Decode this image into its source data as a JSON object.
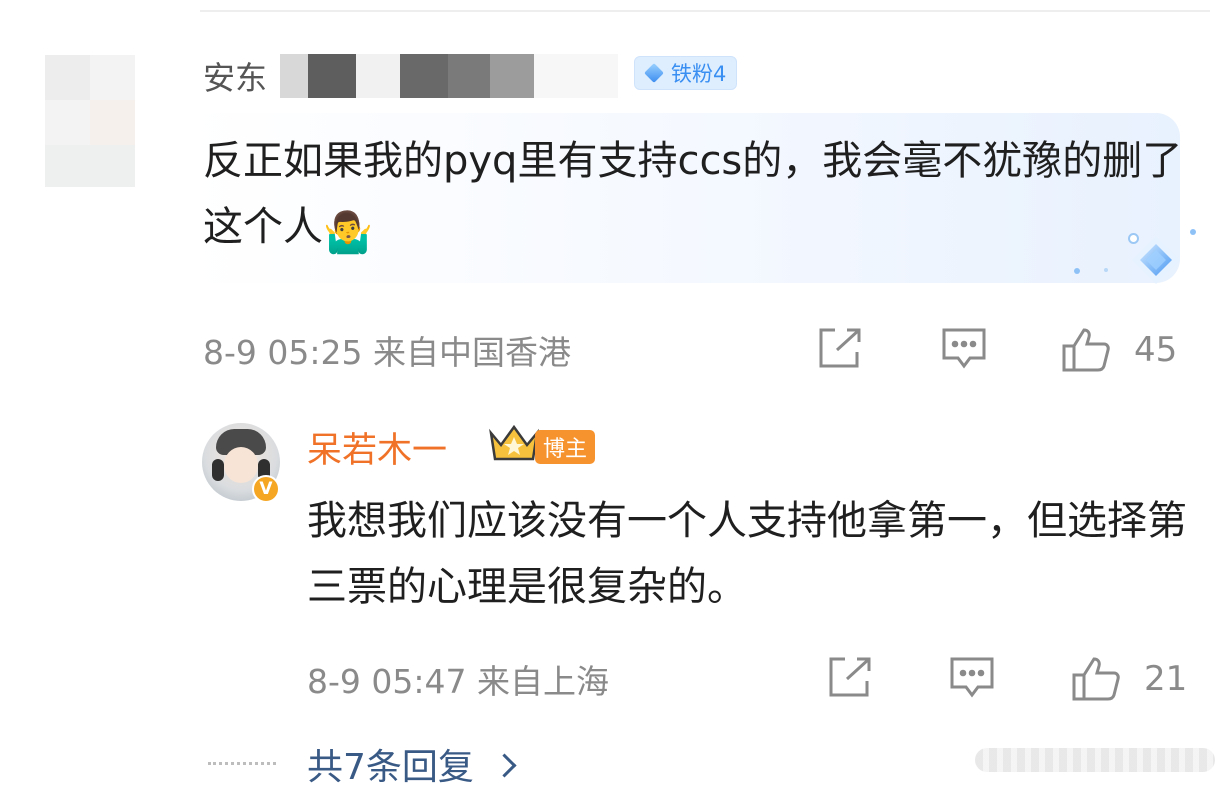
{
  "comment": {
    "username": "安东",
    "fan_badge": "铁粉4",
    "text": "反正如果我的pyq里有支持ccs的，我会毫不犹豫的删了这个人",
    "emoji": "🤷‍♂️",
    "meta": "8-9 05:25 来自中国香港",
    "likes": "45",
    "icons": [
      "share-icon",
      "comment-icon",
      "like-icon"
    ]
  },
  "reply": {
    "username": "呆若木一",
    "host_badge": "博主",
    "verified_badge": "V",
    "text": "我想我们应该没有一个人支持他拿第一，但选择第三票的心理是很复杂的。",
    "meta": "8-9 05:47 来自上海",
    "likes": "21",
    "icons": [
      "share-icon",
      "comment-icon",
      "like-icon"
    ]
  },
  "more_replies": "共7条回复",
  "colors": {
    "username_gray": "#555555",
    "host_orange": "#f07228",
    "link_blue": "#3a5a86",
    "fan_blue": "#3a8ff2"
  }
}
